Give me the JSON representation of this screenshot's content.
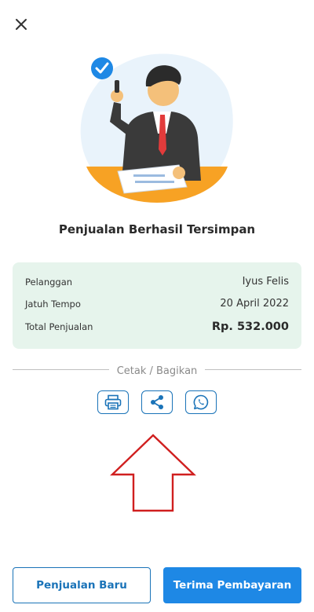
{
  "header": {
    "close_icon": "close-icon"
  },
  "title": "Penjualan Berhasil Tersimpan",
  "summary": {
    "rows": [
      {
        "label": "Pelanggan",
        "value": "Iyus Felis"
      },
      {
        "label": "Jatuh Tempo",
        "value": "20 April 2022"
      },
      {
        "label": "Total Penjualan",
        "value": "Rp. 532.000"
      }
    ]
  },
  "share": {
    "label": "Cetak / Bagikan",
    "icons": [
      "printer-icon",
      "share-icon",
      "whatsapp-icon"
    ]
  },
  "actions": {
    "new_sale": "Penjualan Baru",
    "receive_payment": "Terima Pembayaran"
  },
  "colors": {
    "accent": "#1a73b8",
    "primary_button": "#1e88e5",
    "summary_bg": "#e6f4ec",
    "arrow": "#d01f1f"
  }
}
